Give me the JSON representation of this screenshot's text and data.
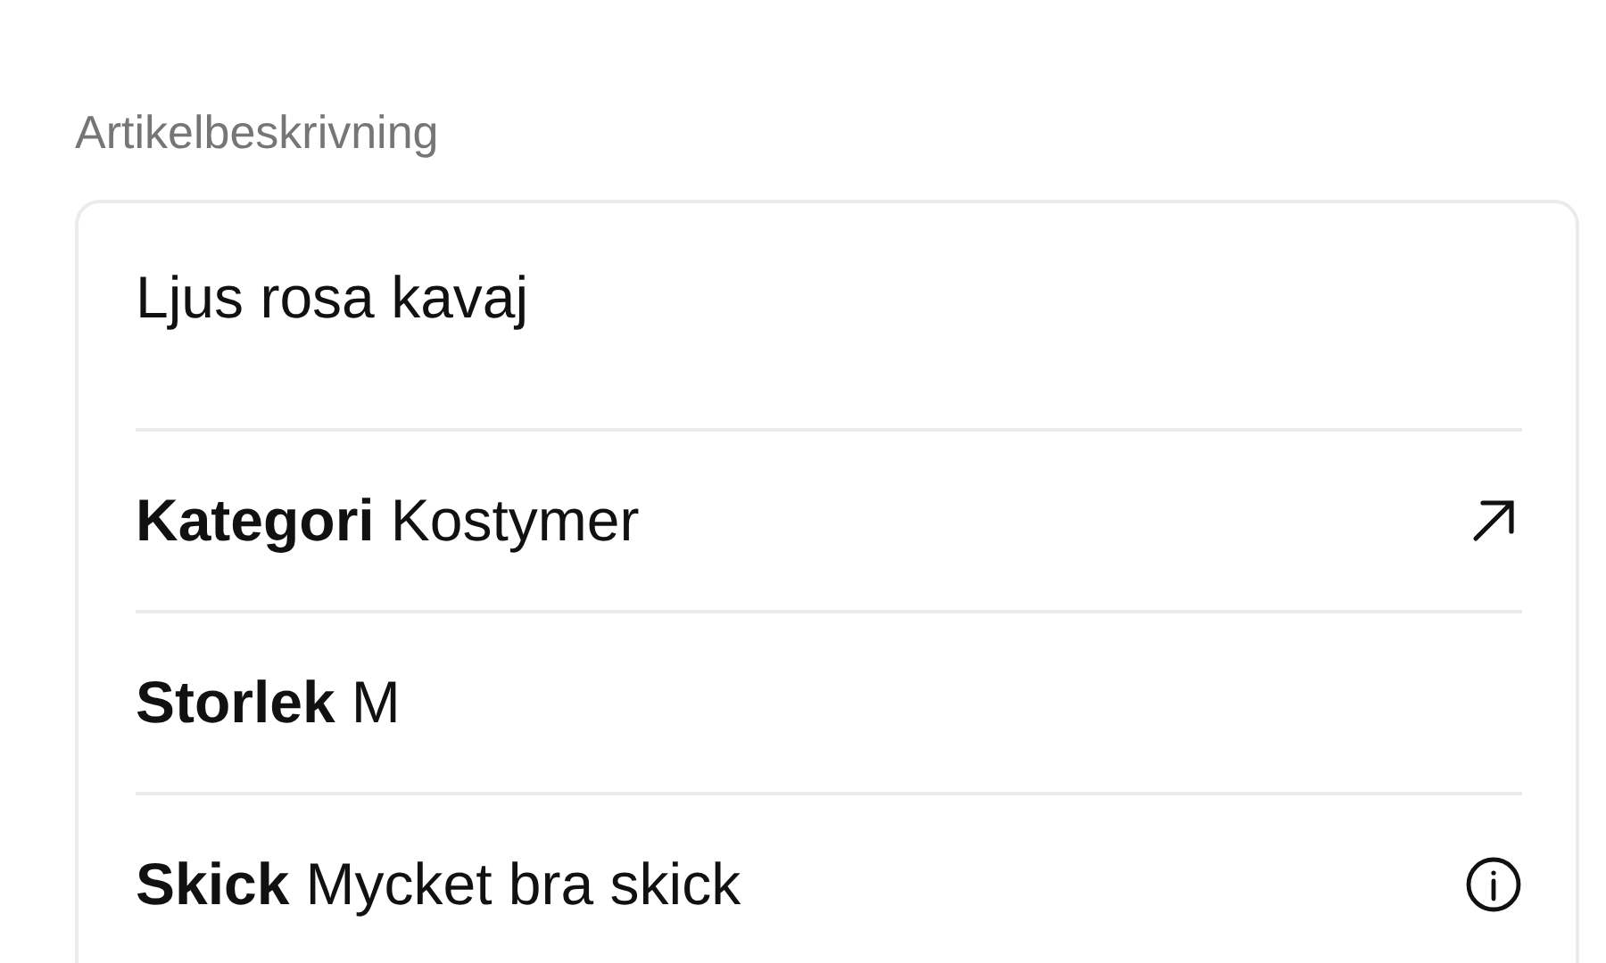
{
  "section_title": "Artikelbeskrivning",
  "card": {
    "title": "Ljus rosa kavaj",
    "rows": [
      {
        "label": "Kategori",
        "value": "Kostymer",
        "kind": "link"
      },
      {
        "label": "Storlek",
        "value": "M",
        "kind": "plain"
      },
      {
        "label": "Skick",
        "value": "Mycket bra skick",
        "kind": "info"
      }
    ]
  }
}
